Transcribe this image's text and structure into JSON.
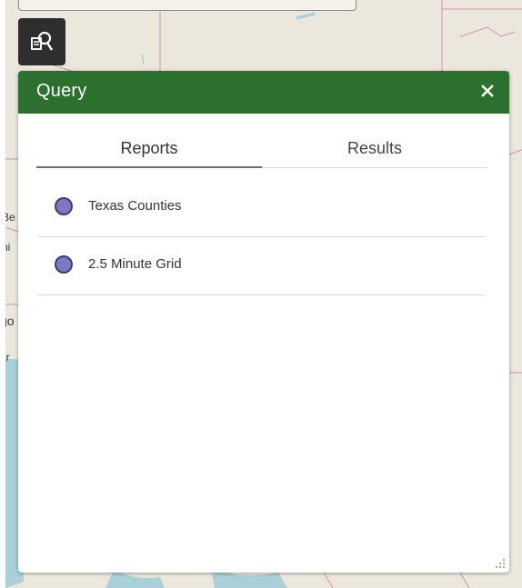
{
  "panel": {
    "title": "Query",
    "close_icon": "close-icon",
    "header_color": "#2d6f2f"
  },
  "toolbar": {
    "query_icon": "query-report-icon"
  },
  "tabs": [
    {
      "label": "Reports",
      "active": true
    },
    {
      "label": "Results",
      "active": false
    }
  ],
  "reports": [
    {
      "label": "Texas Counties",
      "color": "#7c79c1"
    },
    {
      "label": "2.5 Minute Grid",
      "color": "#7c79c1"
    }
  ],
  "map": {
    "edge_labels": [
      "Be",
      "ni",
      "go",
      "er"
    ]
  }
}
